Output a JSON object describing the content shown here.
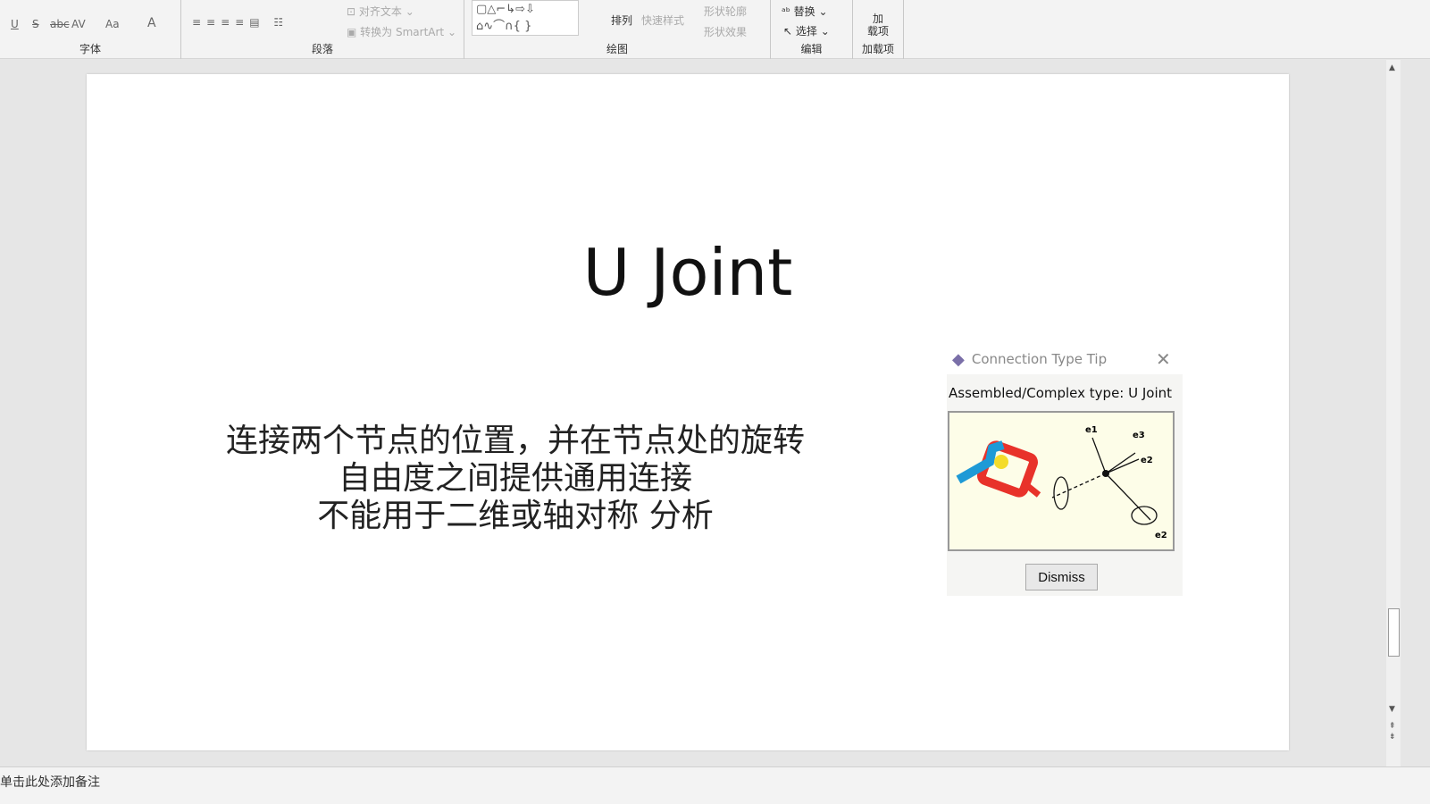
{
  "ribbon": {
    "font": {
      "label": "字体",
      "items": [
        "U",
        "S",
        "abc",
        "AV",
        "Aa",
        "A"
      ]
    },
    "paragraph": {
      "label": "段落",
      "align_text": "对齐文本",
      "smartart": "转换为 SmartArt"
    },
    "drawing": {
      "label": "绘图",
      "arrange": "排列",
      "quick_styles": "快速样式",
      "shape_outline": "形状轮廓",
      "shape_effects": "形状效果"
    },
    "editing": {
      "label": "编辑",
      "replace": "替换",
      "select": "选择"
    },
    "addins": {
      "label": "加载项",
      "button": "加\n载项"
    }
  },
  "slide": {
    "title": "U Joint",
    "body": [
      "连接两个节点的位置，并在节点处的旋转",
      "自由度之间提供通用连接",
      "不能用于二维或轴对称 分析"
    ]
  },
  "tip": {
    "title": "Connection Type Tip",
    "subtitle": "Assembled/Complex type: U Joint",
    "dismiss": "Dismiss",
    "labels": [
      "e1",
      "e3",
      "e2",
      "e2"
    ]
  },
  "status": {
    "notes": "单击此处添加备注"
  }
}
